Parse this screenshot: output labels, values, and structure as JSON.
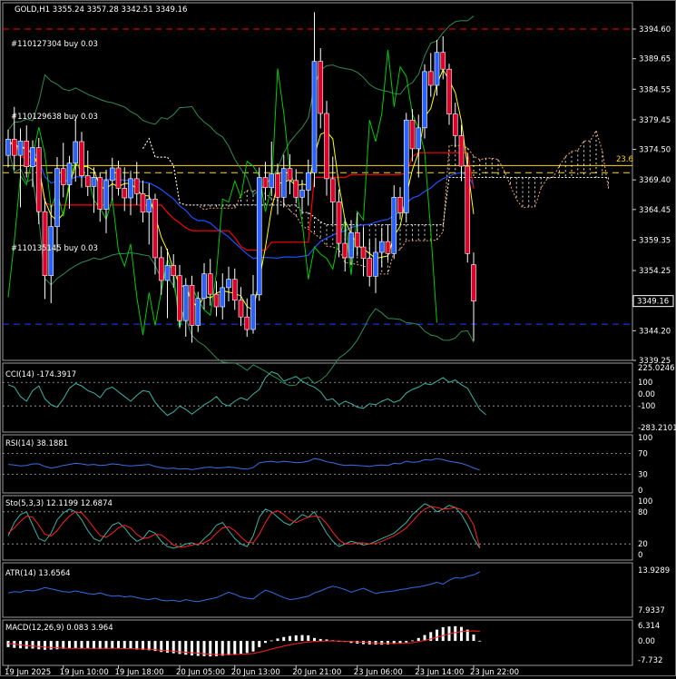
{
  "header": {
    "title": "GOLD,H1  3355.24 3357.28 3342.51 3349.16",
    "trade_labels": [
      "#110127304 buy 0.03",
      "#110129638 buy 0.03",
      "#110135145 buy 0.03"
    ]
  },
  "colors": {
    "background": "#000000",
    "bull_candle": "#2962ff",
    "bear_candle": "#e0002a",
    "ichimoku_cloud": "#ffffff",
    "bollinger": "#2e8b57",
    "ma_fast": "#ffff00",
    "ma_red": "#ff0000",
    "ma_blue": "#1e50ff",
    "envelope_green": "#00cc00",
    "fib_line": "#ffd700",
    "resistance": "#ff0000",
    "support": "#1e3cff",
    "cci": "#3cb3a6",
    "rsi": "#3a6fe0",
    "stoch_main": "#3cb3a6",
    "stoch_signal": "#ff2020",
    "atr": "#2d6ee0",
    "macd_hist": "#ffffff",
    "macd_signal": "#ff2020"
  },
  "chart_data": [
    {
      "type": "candlestick",
      "symbol": "GOLD",
      "timeframe": "H1",
      "title": "GOLD,H1  3355.24 3357.28 3342.51 3349.16",
      "last_ohlc": {
        "open": 3355.24,
        "high": 3357.28,
        "low": 3342.51,
        "close": 3349.16
      },
      "current_price": 3349.16,
      "current_price_label": "3349.16",
      "ylim": [
        3339.25,
        3399.0
      ],
      "y_ticks": [
        3394.6,
        3389.65,
        3384.55,
        3379.45,
        3374.5,
        3369.4,
        3364.45,
        3359.35,
        3354.25,
        3349.15,
        3344.2,
        3339.25
      ],
      "y_tick_labels": [
        "3394.60",
        "3389.65",
        "3384.55",
        "3379.45",
        "3374.50",
        "3369.40",
        "3364.45",
        "3359.35",
        "3354.25",
        "3349.15",
        "3344.20",
        "3339.25"
      ],
      "x_tick_labels": [
        "19 Jun 2025",
        "19 Jun 10:00",
        "19 Jun 18:00",
        "20 Jun 05:00",
        "20 Jun 13:00",
        "20 Jun 21:00",
        "23 Jun 06:00",
        "23 Jun 14:00",
        "23 Jun 22:00"
      ],
      "fib_level": {
        "label": "23.6",
        "price": 3371.8
      },
      "horizontal_levels": [
        {
          "kind": "resistance",
          "price": 3394.6,
          "style": "dashed"
        },
        {
          "kind": "support",
          "price": 3345.3,
          "style": "dashed"
        },
        {
          "kind": "fib",
          "price": 3370.6,
          "style": "dashed"
        }
      ],
      "trade_lines": [
        {
          "label": "#110127304 buy 0.03",
          "price": 3390.6
        },
        {
          "label": "#110129638 buy 0.03",
          "price": 3379.3
        },
        {
          "label": "#110135145 buy 0.03",
          "price": 3358.4
        }
      ],
      "candles": [
        [
          3373.5,
          3377.8,
          3371.5,
          3376.2
        ],
        [
          3376.2,
          3381.6,
          3371.0,
          3373.5
        ],
        [
          3373.5,
          3378.0,
          3364.8,
          3375.9
        ],
        [
          3375.9,
          3378.5,
          3369.8,
          3371.6
        ],
        [
          3371.6,
          3376.0,
          3368.2,
          3374.8
        ],
        [
          3374.8,
          3376.4,
          3362.0,
          3364.1
        ],
        [
          3364.1,
          3366.3,
          3349.5,
          3353.4
        ],
        [
          3353.4,
          3365.2,
          3348.8,
          3361.6
        ],
        [
          3361.6,
          3373.2,
          3357.4,
          3371.3
        ],
        [
          3371.3,
          3375.6,
          3366.5,
          3368.6
        ],
        [
          3368.6,
          3373.4,
          3364.6,
          3372.2
        ],
        [
          3372.2,
          3379.6,
          3369.1,
          3375.8
        ],
        [
          3375.8,
          3377.4,
          3368.1,
          3370.1
        ],
        [
          3370.1,
          3374.3,
          3366.7,
          3368.3
        ],
        [
          3368.3,
          3371.5,
          3363.9,
          3369.8
        ],
        [
          3369.8,
          3370.7,
          3362.4,
          3364.5
        ],
        [
          3364.5,
          3371.1,
          3360.5,
          3369.3
        ],
        [
          3369.3,
          3373.1,
          3366.0,
          3371.4
        ],
        [
          3371.4,
          3372.6,
          3366.8,
          3368.0
        ],
        [
          3368.0,
          3371.5,
          3364.2,
          3366.4
        ],
        [
          3366.4,
          3370.9,
          3363.5,
          3369.6
        ],
        [
          3369.6,
          3372.4,
          3365.2,
          3367.1
        ],
        [
          3367.1,
          3369.3,
          3362.3,
          3364.0
        ],
        [
          3364.0,
          3368.8,
          3358.6,
          3366.2
        ],
        [
          3366.2,
          3367.1,
          3353.6,
          3356.4
        ],
        [
          3356.4,
          3358.3,
          3350.2,
          3352.6
        ],
        [
          3352.6,
          3357.9,
          3346.3,
          3355.1
        ],
        [
          3355.1,
          3357.0,
          3351.4,
          3353.4
        ],
        [
          3353.4,
          3355.2,
          3344.8,
          3345.9
        ],
        [
          3345.9,
          3353.0,
          3343.2,
          3351.8
        ],
        [
          3351.8,
          3353.4,
          3342.2,
          3345.1
        ],
        [
          3345.1,
          3350.7,
          3344.0,
          3349.6
        ],
        [
          3349.6,
          3355.5,
          3347.8,
          3353.7
        ],
        [
          3353.7,
          3356.2,
          3348.4,
          3350.3
        ],
        [
          3350.3,
          3352.5,
          3346.6,
          3348.2
        ],
        [
          3348.2,
          3353.8,
          3346.1,
          3351.4
        ],
        [
          3351.4,
          3354.9,
          3349.1,
          3352.8
        ],
        [
          3352.8,
          3354.6,
          3347.7,
          3349.3
        ],
        [
          3349.3,
          3351.5,
          3345.0,
          3346.5
        ],
        [
          3346.5,
          3349.6,
          3343.2,
          3344.4
        ],
        [
          3344.4,
          3353.5,
          3343.7,
          3350.2
        ],
        [
          3350.2,
          3371.5,
          3349.2,
          3369.8
        ],
        [
          3369.8,
          3372.4,
          3366.0,
          3368.1
        ],
        [
          3368.1,
          3375.8,
          3366.7,
          3370.4
        ],
        [
          3370.4,
          3372.1,
          3363.6,
          3366.5
        ],
        [
          3366.5,
          3373.6,
          3364.8,
          3371.3
        ],
        [
          3371.3,
          3373.7,
          3367.0,
          3369.3
        ],
        [
          3369.3,
          3371.2,
          3365.5,
          3366.5
        ],
        [
          3366.5,
          3369.4,
          3363.9,
          3367.7
        ],
        [
          3367.7,
          3372.8,
          3365.1,
          3370.6
        ],
        [
          3370.6,
          3397.4,
          3368.2,
          3389.2
        ],
        [
          3389.2,
          3391.4,
          3378.0,
          3380.5
        ],
        [
          3380.5,
          3382.6,
          3366.8,
          3369.6
        ],
        [
          3369.6,
          3373.3,
          3362.0,
          3365.7
        ],
        [
          3365.7,
          3367.8,
          3356.5,
          3358.8
        ],
        [
          3358.8,
          3363.0,
          3354.1,
          3356.4
        ],
        [
          3356.4,
          3362.7,
          3355.2,
          3360.6
        ],
        [
          3360.6,
          3363.9,
          3356.7,
          3358.2
        ],
        [
          3358.2,
          3361.5,
          3353.3,
          3356.3
        ],
        [
          3356.3,
          3359.4,
          3351.6,
          3353.3
        ],
        [
          3353.3,
          3359.7,
          3350.5,
          3357.3
        ],
        [
          3357.3,
          3361.4,
          3354.8,
          3359.1
        ],
        [
          3359.1,
          3362.0,
          3355.9,
          3357.1
        ],
        [
          3357.1,
          3368.5,
          3356.2,
          3366.5
        ],
        [
          3366.5,
          3368.2,
          3362.8,
          3363.9
        ],
        [
          3363.9,
          3380.6,
          3362.3,
          3379.4
        ],
        [
          3379.4,
          3381.2,
          3372.5,
          3374.6
        ],
        [
          3374.6,
          3380.3,
          3369.8,
          3378.1
        ],
        [
          3378.1,
          3388.7,
          3376.3,
          3387.5
        ],
        [
          3387.5,
          3390.6,
          3383.3,
          3385.2
        ],
        [
          3385.2,
          3392.8,
          3383.5,
          3390.7
        ],
        [
          3390.7,
          3393.4,
          3386.2,
          3387.9
        ],
        [
          3387.9,
          3388.8,
          3378.6,
          3380.4
        ],
        [
          3380.4,
          3382.3,
          3374.9,
          3376.8
        ],
        [
          3376.8,
          3378.6,
          3369.2,
          3371.7
        ],
        [
          3371.7,
          3373.9,
          3355.6,
          3357.1
        ],
        [
          3355.24,
          3357.28,
          3342.51,
          3349.16
        ]
      ]
    },
    {
      "type": "line",
      "name": "CCI(14)",
      "title": "CCI(14) -174.3917",
      "last_value": -174.3917,
      "ylim": [
        -283.2101,
        225.0246
      ],
      "y_tick_labels": [
        "225.0246",
        "100",
        "0.00",
        "-100",
        "-283.2101"
      ],
      "levels": [
        100,
        -100
      ],
      "values": [
        80,
        60,
        -20,
        -60,
        30,
        70,
        -40,
        -90,
        -110,
        -40,
        50,
        90,
        70,
        30,
        10,
        -30,
        40,
        60,
        20,
        -20,
        -60,
        -10,
        30,
        20,
        -70,
        -130,
        -180,
        -150,
        -100,
        -130,
        -170,
        -130,
        -90,
        -60,
        -20,
        -80,
        -100,
        -60,
        -30,
        -50,
        0,
        40,
        140,
        190,
        170,
        110,
        130,
        150,
        110,
        80,
        60,
        20,
        -50,
        -40,
        -90,
        -60,
        -80,
        -110,
        -120,
        -80,
        -90,
        -60,
        -40,
        -70,
        -50,
        10,
        40,
        60,
        90,
        80,
        110,
        140,
        100,
        120,
        80,
        50,
        -40,
        -130,
        -174.39
      ]
    },
    {
      "type": "line",
      "name": "RSI(14)",
      "title": "RSI(14) 38.1881",
      "last_value": 38.1881,
      "ylim": [
        0,
        100
      ],
      "y_tick_labels": [
        "100",
        "70",
        "30",
        "0"
      ],
      "levels": [
        70,
        30
      ],
      "values": [
        49,
        48,
        46,
        47,
        50,
        50,
        45,
        42,
        44,
        47,
        49,
        51,
        50,
        48,
        49,
        47,
        48,
        50,
        49,
        47,
        46,
        47,
        48,
        49,
        45,
        43,
        41,
        42,
        40,
        41,
        39,
        41,
        43,
        44,
        42,
        43,
        44,
        43,
        41,
        40,
        43,
        52,
        54,
        55,
        53,
        55,
        54,
        52,
        53,
        55,
        60,
        58,
        54,
        52,
        49,
        47,
        48,
        47,
        46,
        45,
        47,
        48,
        47,
        51,
        50,
        55,
        53,
        54,
        58,
        57,
        60,
        58,
        55,
        53,
        51,
        47,
        42,
        38.19
      ]
    },
    {
      "type": "line",
      "name": "Sto(5,3,3)",
      "title": "Sto(5,3,3) 12.1199 12.6874",
      "main_last": 12.1199,
      "signal_last": 12.6874,
      "ylim": [
        0,
        100
      ],
      "y_tick_labels": [
        "100",
        "80",
        "20",
        "0"
      ],
      "levels": [
        80,
        20
      ],
      "main": [
        35,
        60,
        75,
        80,
        55,
        30,
        25,
        40,
        65,
        78,
        85,
        80,
        65,
        45,
        30,
        25,
        40,
        55,
        60,
        50,
        35,
        25,
        30,
        45,
        40,
        25,
        15,
        12,
        15,
        20,
        22,
        18,
        30,
        40,
        55,
        60,
        45,
        30,
        20,
        15,
        35,
        70,
        85,
        80,
        70,
        60,
        55,
        65,
        75,
        70,
        80,
        60,
        40,
        25,
        15,
        20,
        25,
        22,
        18,
        20,
        25,
        30,
        35,
        40,
        50,
        60,
        75,
        85,
        95,
        90,
        80,
        85,
        92,
        88,
        75,
        55,
        30,
        12.12
      ],
      "signal": [
        40,
        50,
        62,
        72,
        70,
        55,
        38,
        35,
        45,
        60,
        72,
        80,
        78,
        65,
        50,
        36,
        32,
        40,
        50,
        55,
        50,
        38,
        30,
        32,
        38,
        37,
        28,
        18,
        14,
        15,
        18,
        20,
        22,
        28,
        40,
        50,
        52,
        45,
        33,
        23,
        22,
        38,
        60,
        78,
        82,
        75,
        65,
        60,
        65,
        70,
        72,
        70,
        58,
        42,
        28,
        20,
        20,
        22,
        22,
        20,
        21,
        25,
        30,
        35,
        42,
        50,
        62,
        75,
        85,
        90,
        88,
        85,
        86,
        88,
        84,
        75,
        55,
        12.69
      ]
    },
    {
      "type": "line",
      "name": "ATR(14)",
      "title": "ATR(14) 13.6564",
      "last_value": 13.6564,
      "ylim": [
        7.9337,
        13.9289
      ],
      "y_tick_labels": [
        "13.9289",
        "7.9337"
      ],
      "values": [
        10.5,
        10.7,
        10.6,
        10.9,
        10.8,
        11.0,
        11.3,
        11.1,
        10.9,
        10.7,
        10.6,
        10.8,
        10.6,
        10.4,
        10.3,
        10.5,
        10.2,
        10.0,
        10.1,
        9.9,
        10.0,
        9.8,
        9.6,
        9.5,
        9.7,
        9.4,
        9.3,
        9.4,
        9.2,
        9.5,
        9.3,
        9.2,
        9.4,
        9.6,
        9.8,
        10.2,
        10.6,
        10.3,
        9.9,
        9.7,
        9.6,
        10.3,
        10.9,
        10.6,
        10.2,
        9.8,
        9.5,
        9.6,
        9.8,
        10.0,
        10.5,
        10.8,
        11.2,
        11.5,
        11.3,
        11.0,
        10.6,
        10.9,
        11.2,
        10.8,
        10.4,
        10.6,
        10.7,
        10.8,
        11.0,
        11.1,
        11.3,
        11.4,
        11.6,
        11.8,
        12.1,
        11.8,
        12.4,
        12.8,
        12.7,
        13.0,
        13.2,
        13.66
      ]
    },
    {
      "type": "bar",
      "name": "MACD(12,26,9)",
      "title": "MACD(12,26,9) 0.083 3.964",
      "macd_last": 0.083,
      "signal_last": 3.964,
      "ylim": [
        -7.732,
        6.314
      ],
      "y_tick_labels": [
        "6.314",
        "0.00",
        "-7.732"
      ],
      "histogram": [
        -2.5,
        -2.8,
        -3.0,
        -3.2,
        -3.1,
        -3.4,
        -3.6,
        -3.5,
        -3.4,
        -3.2,
        -3.0,
        -2.9,
        -3.0,
        -3.1,
        -3.2,
        -3.3,
        -3.2,
        -3.1,
        -3.0,
        -3.1,
        -3.3,
        -3.5,
        -3.6,
        -3.8,
        -4.1,
        -4.5,
        -4.8,
        -5.0,
        -5.3,
        -5.6,
        -5.9,
        -6.1,
        -6.2,
        -6.3,
        -6.2,
        -6.0,
        -5.8,
        -5.5,
        -5.2,
        -4.9,
        -4.3,
        -2.5,
        -0.8,
        0.2,
        1.0,
        1.6,
        2.0,
        2.3,
        2.4,
        2.3,
        1.2,
        0.8,
        0.6,
        0.3,
        0.0,
        -0.4,
        -0.8,
        -1.1,
        -1.3,
        -1.4,
        -1.5,
        -1.5,
        -1.4,
        -1.2,
        -1.0,
        -0.6,
        0.2,
        1.2,
        2.4,
        3.6,
        4.6,
        5.6,
        5.9,
        6.0,
        5.7,
        4.6,
        2.6,
        0.08
      ],
      "signal": [
        -1.0,
        -1.3,
        -1.6,
        -1.9,
        -2.1,
        -2.3,
        -2.5,
        -2.7,
        -2.8,
        -2.9,
        -3.0,
        -3.0,
        -3.0,
        -3.0,
        -3.0,
        -3.0,
        -3.0,
        -3.0,
        -3.0,
        -3.1,
        -3.1,
        -3.2,
        -3.3,
        -3.4,
        -3.6,
        -3.8,
        -4.0,
        -4.2,
        -4.4,
        -4.6,
        -4.8,
        -5.0,
        -5.2,
        -5.4,
        -5.5,
        -5.5,
        -5.5,
        -5.5,
        -5.4,
        -5.3,
        -5.1,
        -4.6,
        -4.0,
        -3.3,
        -2.7,
        -2.1,
        -1.6,
        -1.1,
        -0.7,
        -0.4,
        -0.2,
        -0.1,
        0.0,
        0.0,
        0.0,
        -0.1,
        -0.2,
        -0.4,
        -0.5,
        -0.7,
        -0.8,
        -0.9,
        -1.0,
        -1.0,
        -1.0,
        -0.9,
        -0.7,
        -0.3,
        0.2,
        0.8,
        1.5,
        2.2,
        2.9,
        3.4,
        3.8,
        4.0,
        4.1,
        3.96
      ]
    }
  ]
}
